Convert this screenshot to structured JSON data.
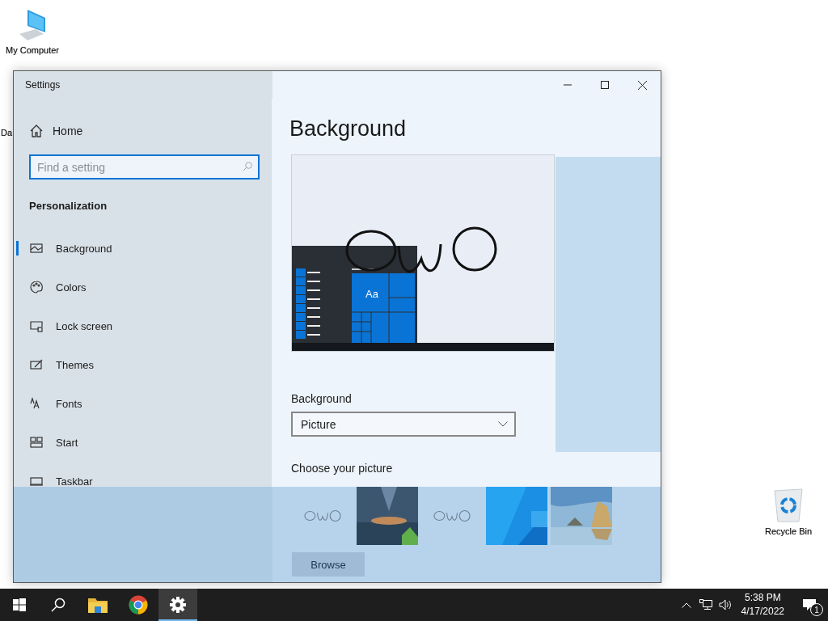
{
  "desktop_icons": [
    {
      "kind": "computer",
      "label": "My Computer"
    },
    {
      "kind": "partial",
      "label": "Da"
    },
    {
      "kind": "recycle",
      "label": "Recycle Bin"
    }
  ],
  "window": {
    "title": "Settings"
  },
  "sidebar": {
    "home": "Home",
    "search": {
      "placeholder": "Find a setting"
    },
    "section": "Personalization",
    "items": [
      {
        "kind": "background",
        "label": "Background",
        "selected": true
      },
      {
        "kind": "colors",
        "label": "Colors",
        "selected": false
      },
      {
        "kind": "lock",
        "label": "Lock screen",
        "selected": false
      },
      {
        "kind": "themes",
        "label": "Themes",
        "selected": false
      },
      {
        "kind": "fonts",
        "label": "Fonts",
        "selected": false
      },
      {
        "kind": "start",
        "label": "Start",
        "selected": false
      },
      {
        "kind": "taskbar",
        "label": "Taskbar",
        "selected": false
      }
    ]
  },
  "main": {
    "title": "Background",
    "preview": {
      "tile_text": "Aa"
    },
    "background_label": "Background",
    "background_value": "Picture",
    "choose_label": "Choose your picture",
    "thumbnails": [
      {
        "kind": "doodle"
      },
      {
        "kind": "picture"
      },
      {
        "kind": "doodle"
      },
      {
        "kind": "picture"
      },
      {
        "kind": "picture"
      }
    ],
    "browse": "Browse"
  },
  "taskbar": {
    "items": [
      {
        "kind": "start",
        "selected": false
      },
      {
        "kind": "search",
        "selected": false
      },
      {
        "kind": "explorer",
        "selected": false
      },
      {
        "kind": "browser",
        "selected": false
      },
      {
        "kind": "settings",
        "selected": true
      }
    ],
    "time": "5:38 PM",
    "date": "4/17/2022",
    "notifications": "1"
  }
}
